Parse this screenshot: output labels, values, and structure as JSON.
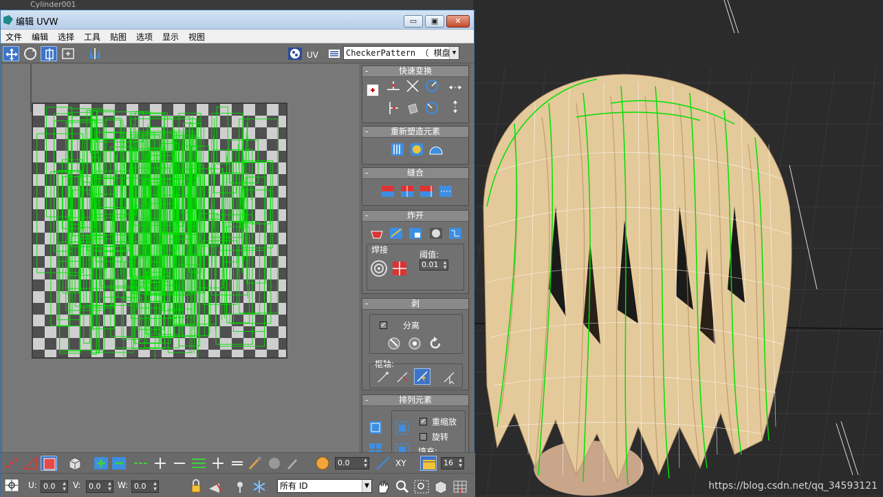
{
  "background_object": {
    "label": "Cylinder001"
  },
  "window": {
    "title": "编辑 UVW",
    "buttons": {
      "minimize": "▭",
      "maximize": "▣",
      "close": "✕"
    }
  },
  "menu": [
    "文件",
    "编辑",
    "选择",
    "工具",
    "贴图",
    "选项",
    "显示",
    "视图"
  ],
  "toolbar": {
    "uv_label": "UV",
    "texture_dropdown": "CheckerPattern （ 棋盘"
  },
  "panel": {
    "quick_transform": {
      "title": "快速变换"
    },
    "reshape": {
      "title": "重新塑造元素"
    },
    "stitch": {
      "title": "缝合"
    },
    "explode": {
      "title": "炸开",
      "weld_label": "焊接",
      "threshold_label": "阈值:",
      "threshold_value": "0.01"
    },
    "peel": {
      "title": "剥",
      "detach_label": "分离",
      "detach_checked": true,
      "pivot_label": "枢轴:"
    },
    "arrange": {
      "title": "排列元素",
      "rescale_label": "重缩放",
      "rescale_checked": true,
      "rotate_label": "旋转",
      "rotate_checked": false,
      "padding_label": "填充:"
    }
  },
  "bottom": {
    "soft_select_value": "0.0",
    "xy_label": "XY",
    "count_value": "16",
    "u_label": "U:",
    "u_value": "0.0",
    "v_label": "V:",
    "v_value": "0.0",
    "w_label": "W:",
    "w_value": "0.0",
    "id_dropdown": "所有 ID"
  },
  "watermark": "https://blog.csdn.net/qq_34593121",
  "colors": {
    "uv_wire": "#00e000",
    "hair_fill": "#e4c99a",
    "selection_blue": "#3d74c8",
    "titlebar": "#c5d8ef"
  }
}
